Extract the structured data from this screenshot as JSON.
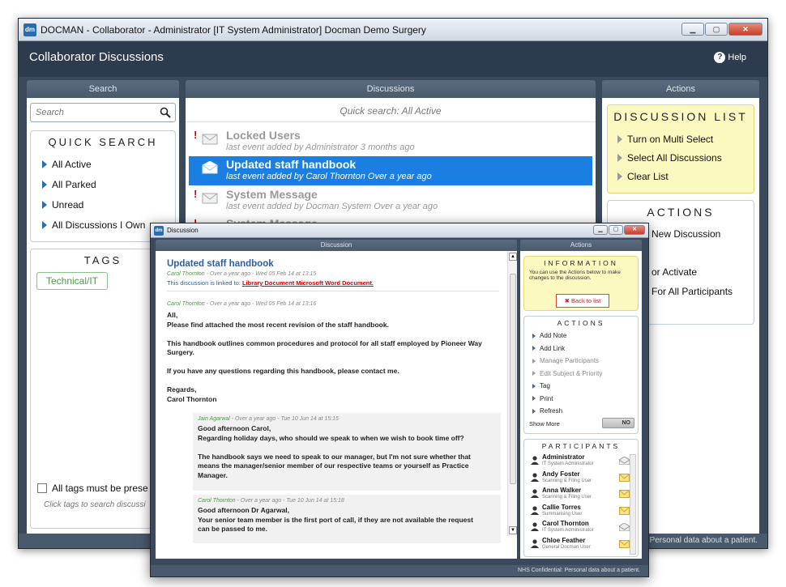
{
  "window": {
    "title": "DOCMAN - Collaborator - Administrator [IT System Administrator] Docman Demo Surgery",
    "app_title": "Collaborator Discussions",
    "help_label": "Help"
  },
  "panels": {
    "search": "Search",
    "discussions": "Discussions",
    "actions": "Actions"
  },
  "search": {
    "placeholder": "Search"
  },
  "quick_search": {
    "title": "QUICK SEARCH",
    "items": [
      "All Active",
      "All Parked",
      "Unread",
      "All Discussions I Own"
    ]
  },
  "tags": {
    "title": "TAGS",
    "items": [
      "Technical/IT"
    ],
    "all_tags_label": "All tags must be prese",
    "hint": "Click tags to search discussi"
  },
  "discussions": {
    "quick_search_label": "Quick search: All Active",
    "rows": [
      {
        "title": "Locked Users",
        "sub": "last event added by Administrator 3 months ago",
        "flag": "!"
      },
      {
        "title": "Updated staff handbook",
        "sub": "last event added by Carol Thornton Over a year ago",
        "flag": ""
      },
      {
        "title": "System Message",
        "sub": "last event added by Docman System Over a year ago",
        "flag": "!"
      },
      {
        "title": "System Message",
        "sub": "",
        "flag": "!"
      }
    ]
  },
  "discussion_list": {
    "title": "DISCUSSION LIST",
    "items": [
      "Turn on Multi Select",
      "Select All Discussions",
      "Clear List"
    ]
  },
  "main_actions": {
    "title": "ACTIONS",
    "items": [
      "New Discussion",
      "or Activate",
      "For All Participants"
    ]
  },
  "status": "Personal data about a patient.",
  "dialog": {
    "title": "Discussion",
    "panel_discussion": "Discussion",
    "panel_actions": "Actions",
    "subject": "Updated staff handbook",
    "header_meta_name": "Carol Thornton",
    "header_meta_time": " - Over a year ago - Wed 05 Feb 14 at 13:15",
    "linked_prefix": "This discussion is linked to: ",
    "linked_doc": "Library Document Microsoft Word Document.",
    "message": {
      "meta_name": "Carol Thornton",
      "meta_time": " - Over a year ago - Wed 05 Feb 14 at 13:16",
      "lines": [
        "All,",
        "Please find attached the most recent revision of the staff handbook.",
        "",
        "This handbook outlines common procedures and protocol for all staff employed by Pioneer Way",
        "Surgery.",
        "",
        "If you have any questions regarding this handbook, please contact me.",
        "",
        "Regards,",
        "Carol Thornton"
      ]
    },
    "reply1": {
      "meta_name": "Jain Agarwal",
      "meta_time": " - Over a year ago - Tue 10 Jun 14 at 15:15",
      "lines": [
        "Good afternoon Carol,",
        "Regarding holiday days, who should we speak to when we wish to book time off?",
        "",
        "The handbook says we need to speak to our manager, but I'm not sure whether that",
        "means the manager/senior member of our respective teams or yourself as Practice",
        "Manager."
      ]
    },
    "reply2": {
      "meta_name": "Carol Thornton",
      "meta_time": " - Over a year ago - Tue 10 Jun 14 at 15:18",
      "lines": [
        "Good afternoon Dr Agarwal,",
        "Your senior team member is the first port of call, if they are not available the request",
        "can be passed to me."
      ]
    },
    "information": {
      "title": "INFORMATION",
      "text": "You can use the Actions below to make changes to the discussion.",
      "back_label": "Back to list"
    },
    "actions": {
      "title": "ACTIONS",
      "items": [
        {
          "label": "Add Note",
          "enabled": true
        },
        {
          "label": "Add Link",
          "enabled": true
        },
        {
          "label": "Manage Participants",
          "enabled": false
        },
        {
          "label": "Edit Subject & Priority",
          "enabled": false
        },
        {
          "label": "Tag",
          "enabled": true
        },
        {
          "label": "Print",
          "enabled": true
        },
        {
          "label": "Refresh",
          "enabled": true
        }
      ],
      "show_more_label": "Show More",
      "toggle_value": "NO"
    },
    "participants": {
      "title": "PARTICIPANTS",
      "list": [
        {
          "name": "Administrator",
          "role": "IT System Administrator",
          "read": true
        },
        {
          "name": "Andy Foster",
          "role": "Scanning & Filing User",
          "read": false
        },
        {
          "name": "Anna Walker",
          "role": "Scanning & Filing User",
          "read": false
        },
        {
          "name": "Callie Torres",
          "role": "Summarising User",
          "read": false
        },
        {
          "name": "Carol Thornton",
          "role": "IT System Administrator",
          "read": true
        },
        {
          "name": "Chloe Feather",
          "role": "General Docman User",
          "read": false
        }
      ]
    },
    "status": "NHS Confidential: Personal data about a patient."
  },
  "colors": {
    "selected_row": "#1a7fe0",
    "header": "#2c3c4e",
    "accent_blue": "#2a6cb0",
    "info_yellow": "#fcf9c0",
    "alert_red": "#dd0000"
  }
}
